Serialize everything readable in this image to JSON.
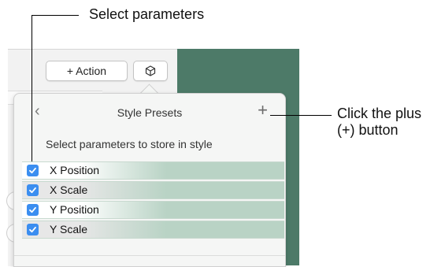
{
  "callouts": {
    "select": "Select parameters",
    "plus_line1": "Click the plus",
    "plus_line2": "(+) button"
  },
  "toolbar": {
    "action_label": "+ Action",
    "cube_icon": "cube-icon"
  },
  "popover": {
    "back_icon": "chevron-left-icon",
    "title": "Style Presets",
    "add_icon": "plus-icon",
    "subtitle": "Select parameters to store in style",
    "items": [
      {
        "label": "X Position",
        "checked": true
      },
      {
        "label": "X Scale",
        "checked": true
      },
      {
        "label": "Y Position",
        "checked": true
      },
      {
        "label": "Y Scale",
        "checked": true
      }
    ]
  },
  "colors": {
    "accent": "#3b8ef0",
    "teal_background": "#4d7a68",
    "row_highlight": "#b9d3c5"
  }
}
